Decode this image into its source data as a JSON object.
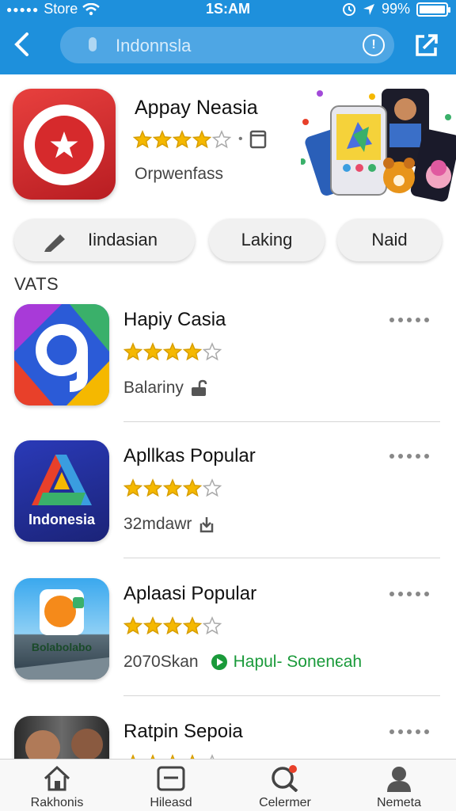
{
  "status": {
    "carrier": "Store",
    "time": "1S:AM",
    "battery": "99%",
    "battery_level": 0.99
  },
  "header": {
    "search_text": "Indonnsla"
  },
  "featured": {
    "title": "Appay Neasia",
    "subtitle": "Orpwenfass",
    "rating": 4,
    "rating_max": 5
  },
  "chips": [
    "Iindasian",
    "Laking",
    "Naid"
  ],
  "section_title": "VATS",
  "apps": [
    {
      "name": "Hapiy Casia",
      "rating": 4,
      "meta": "Balarіny",
      "meta_icon": "lock-icon",
      "badge": ""
    },
    {
      "name": "Apllkas Popular",
      "rating": 4,
      "meta": "32mdawr",
      "meta_icon": "download-icon",
      "icon_text": "Indonesia",
      "badge": ""
    },
    {
      "name": "Aplaasi Popular",
      "rating": 4,
      "meta": "2070Skan",
      "meta_icon": "",
      "icon_text": "Bolabolabo",
      "badge": "Hapul- Sonenєah"
    },
    {
      "name": "Ratpin Sepoia",
      "rating": 4,
      "meta": "",
      "meta_icon": "",
      "badge": ""
    }
  ],
  "tabs": [
    {
      "label": "Rakhonis",
      "icon": "home-icon"
    },
    {
      "label": "Hileasd",
      "icon": "inbox-icon"
    },
    {
      "label": "Celermer",
      "icon": "search-icon"
    },
    {
      "label": "Nemeta",
      "icon": "person-icon"
    }
  ],
  "colors": {
    "header": "#1e90dc",
    "star": "#f5b800",
    "badge": "#1a9a3a"
  }
}
